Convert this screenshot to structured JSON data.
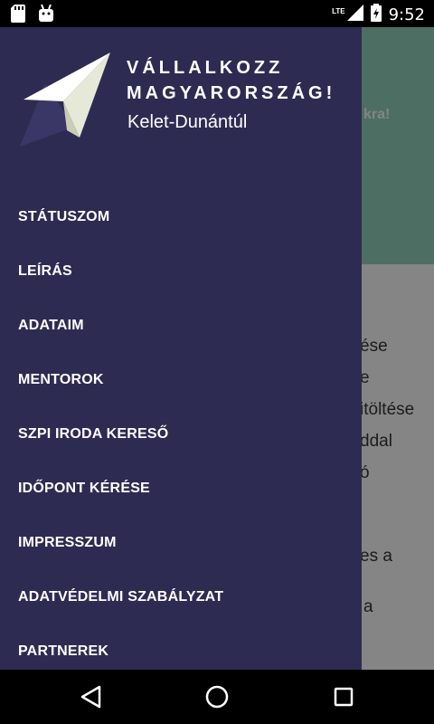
{
  "status_bar": {
    "time": "9:52",
    "network_label": "LTE",
    "icons": [
      "sd-card-icon",
      "android-debug-icon",
      "signal-icon",
      "battery-icon"
    ]
  },
  "background_app": {
    "promo_text": "kra!",
    "body_lines": [
      "ése",
      "e",
      "itöltése",
      "ddal",
      "ó",
      "es a",
      "a"
    ]
  },
  "drawer": {
    "brand_line1": "VÁLLALKOZZ",
    "brand_line2": "MAGYARORSZÁG!",
    "region": "Kelet-Dunántúl",
    "menu_items": [
      "STÁTUSZOM",
      "LEÍRÁS",
      "ADATAIM",
      "MENTOROK",
      "SZPI IRODA KERESŐ",
      "IDŐPONT KÉRÉSE",
      "IMPRESSZUM",
      "ADATVÉDELMI SZABÁLYZAT",
      "PARTNEREK"
    ]
  },
  "colors": {
    "drawer_bg": "#2e2b52",
    "header_green": "#8cc8b5",
    "text": "#ffffff"
  }
}
